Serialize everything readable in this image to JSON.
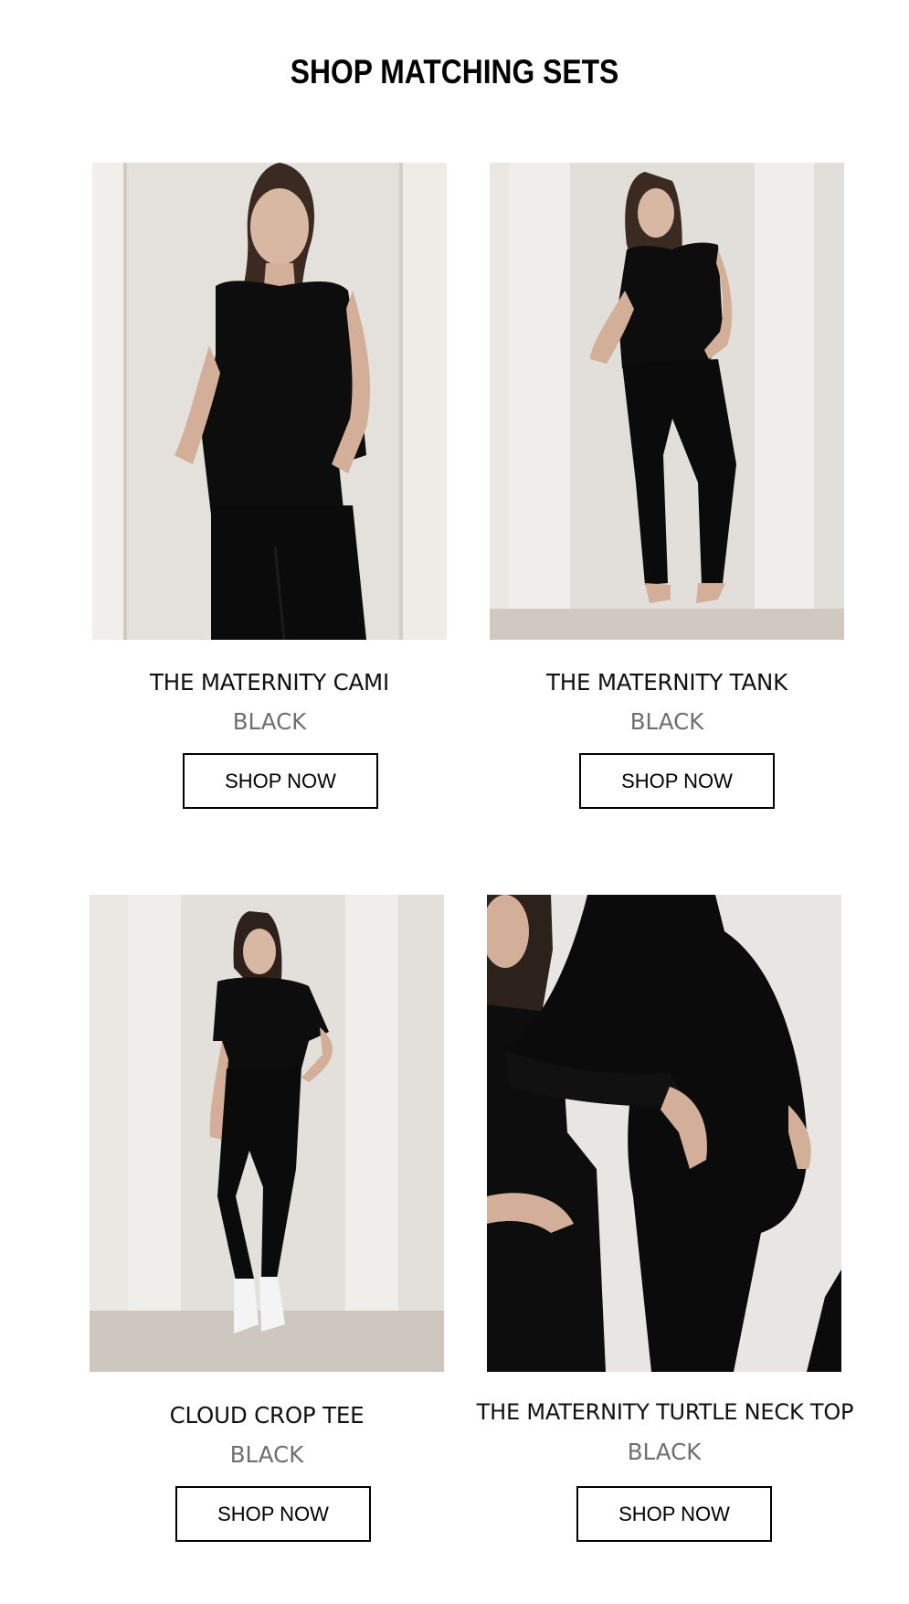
{
  "header": {
    "title": "SHOP MATCHING SETS"
  },
  "products": [
    {
      "name": "THE MATERNITY CAMI",
      "color": "BLACK",
      "button": "SHOP NOW"
    },
    {
      "name": "THE MATERNITY TANK",
      "color": "BLACK",
      "button": "SHOP NOW"
    },
    {
      "name": "CLOUD CROP TEE",
      "color": "BLACK",
      "button": "SHOP NOW"
    },
    {
      "name": "THE MATERNITY TURTLE NECK TOP",
      "color": "BLACK",
      "button": "SHOP NOW"
    }
  ],
  "colors": {
    "background": "#ffffff",
    "text": "#111111",
    "muted": "#6f6f6f",
    "garment": "#0d0d0d",
    "wall": "#e7e4e0"
  }
}
